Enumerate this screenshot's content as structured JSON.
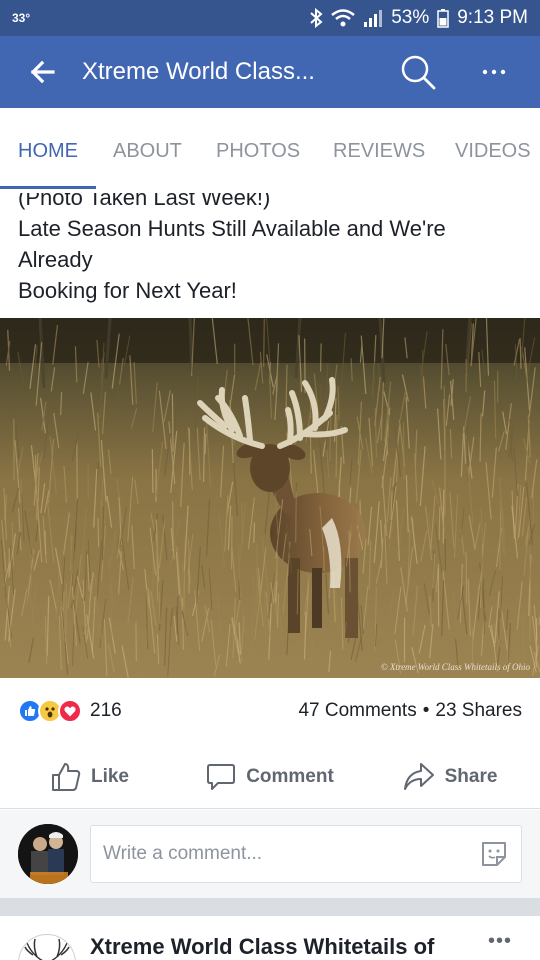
{
  "status_bar": {
    "temperature": "33°",
    "battery": "53%",
    "time": "9:13 PM"
  },
  "app_bar": {
    "title": "Xtreme World Class..."
  },
  "tabs": [
    {
      "label": "HOME",
      "active": true
    },
    {
      "label": "ABOUT",
      "active": false
    },
    {
      "label": "PHOTOS",
      "active": false
    },
    {
      "label": "REVIEWS",
      "active": false
    },
    {
      "label": "VIDEOS",
      "active": false
    }
  ],
  "post": {
    "text_lines": [
      "(Photo Taken Last Week!)",
      "Late Season Hunts Still Available and We're",
      "Already",
      "Booking for Next Year!"
    ],
    "photo_watermark": "© Xtreme World Class Whitetails of Ohio",
    "reaction_count": "216",
    "comments": "47 Comments",
    "separator": "•",
    "shares": "23 Shares",
    "actions": {
      "like": "Like",
      "comment": "Comment",
      "share": "Share"
    },
    "comment_placeholder": "Write a comment..."
  },
  "next_post": {
    "page_name": "Xtreme World Class Whitetails of",
    "more": "•••"
  },
  "colors": {
    "status_bar": "#36558f",
    "app_bar": "#4267b2",
    "active_tab": "#4267b2",
    "inactive_tab": "#8d949e",
    "like_reaction": "#2078f4",
    "wow_reaction": "#f7c844",
    "love_reaction": "#f0284a"
  }
}
